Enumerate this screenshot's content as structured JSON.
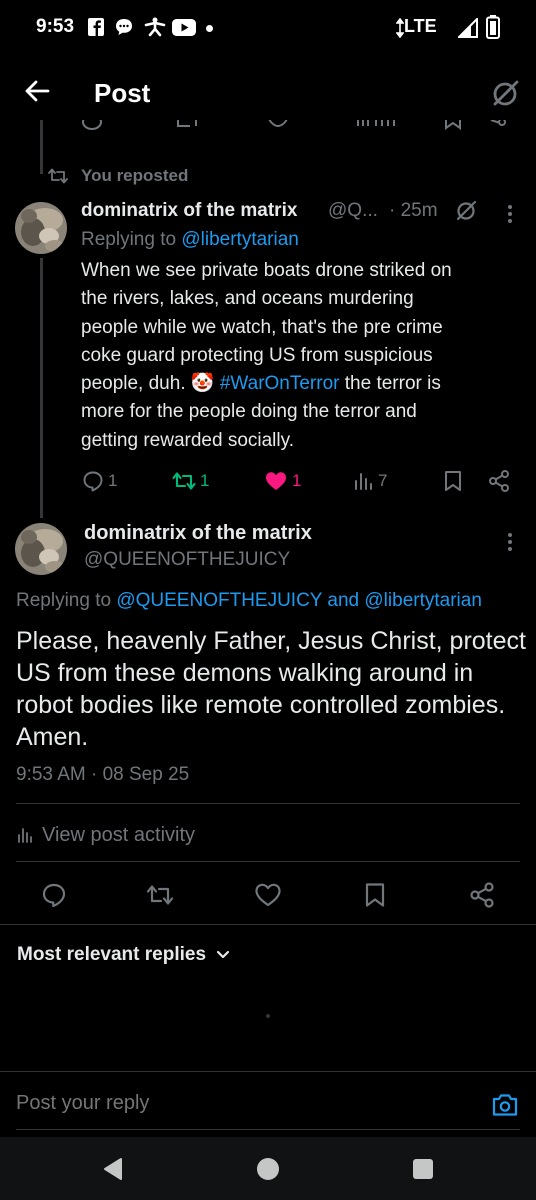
{
  "status_bar": {
    "time": "9:53",
    "network": "LTE"
  },
  "header": {
    "title": "Post",
    "back_icon": "arrow-left-icon",
    "grok_icon": "slash-circle-icon"
  },
  "parent_post": {
    "repost_label": "You reposted",
    "author_name": "dominatrix of the matrix",
    "author_handle": "@Q...",
    "time": "· 25m",
    "replying_prefix": "Replying to",
    "replying_to": "@libertytarian",
    "text_lines": [
      "When we see private boats drone striked on",
      "the rivers, lakes, and oceans murdering",
      "people while we watch, that's the pre crime",
      "coke guard protecting US from suspicious"
    ],
    "line5_before": "people, duh. ",
    "emoji": "🤡",
    "hashtag": "#WarOnTerror",
    "line5_after": " the terror is",
    "text_lines_end": [
      "more for the people doing the terror and",
      "getting rewarded socially."
    ],
    "actions": {
      "replies": "1",
      "reposts": "1",
      "likes": "1",
      "views": "7"
    },
    "colors": {
      "repost_active": "#00ba7c",
      "like_active": "#f91880"
    }
  },
  "main_post": {
    "author_name": "dominatrix of the matrix",
    "author_handle": "@QUEENOFTHEJUICY",
    "replying_prefix": "Replying to",
    "replying_to": "@QUEENOFTHEJUICY and @libertytarian",
    "text_lines": [
      "Please, heavenly Father, Jesus Christ, protect",
      "US from these demons walking around in",
      "robot bodies like remote controlled zombies.",
      "Amen."
    ],
    "timestamp": "9:53 AM · 08 Sep 25",
    "activity_label": "View post activity"
  },
  "replies_section": {
    "sort_label": "Most relevant replies"
  },
  "reply_bar": {
    "placeholder": "Post your reply"
  },
  "theme": {
    "background": "#000000",
    "accent": "#1d9bf0",
    "muted": "#71767b"
  }
}
